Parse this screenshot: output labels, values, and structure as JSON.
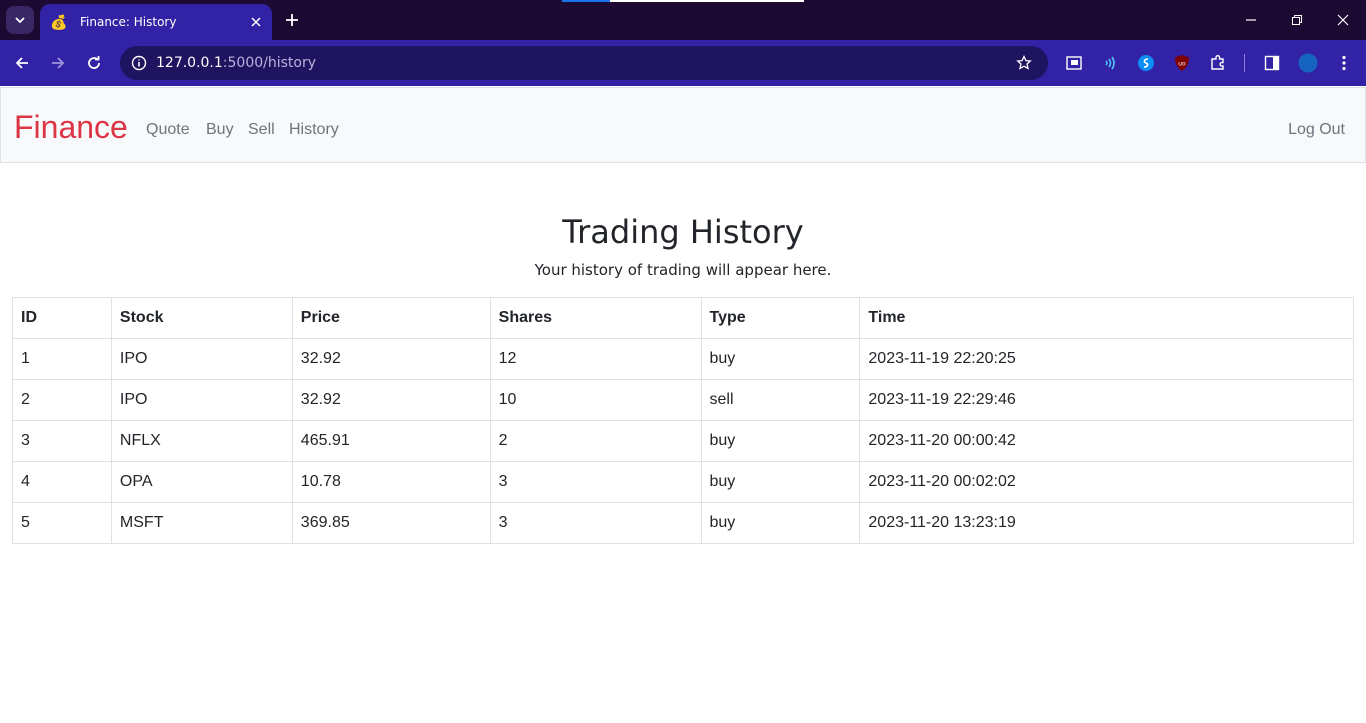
{
  "browser": {
    "tab_title": "Finance: History",
    "url_host": "127.0.0.1",
    "url_path": ":5000/history"
  },
  "navbar": {
    "brand": "Finance",
    "links": [
      "Quote",
      "Buy",
      "Sell",
      "History"
    ],
    "logout": "Log Out"
  },
  "main": {
    "title": "Trading History",
    "subtitle": "Your history of trading will appear here."
  },
  "table": {
    "headers": [
      "ID",
      "Stock",
      "Price",
      "Shares",
      "Type",
      "Time"
    ],
    "rows": [
      [
        "1",
        "IPO",
        "32.92",
        "12",
        "buy",
        "2023-11-19 22:20:25"
      ],
      [
        "2",
        "IPO",
        "32.92",
        "10",
        "sell",
        "2023-11-19 22:29:46"
      ],
      [
        "3",
        "NFLX",
        "465.91",
        "2",
        "buy",
        "2023-11-20 00:00:42"
      ],
      [
        "4",
        "OPA",
        "10.78",
        "3",
        "buy",
        "2023-11-20 00:02:02"
      ],
      [
        "5",
        "MSFT",
        "369.85",
        "3",
        "buy",
        "2023-11-20 13:23:19"
      ]
    ]
  },
  "colors": {
    "brand": "#dc3545",
    "chrome": "#3223a6",
    "tabstrip": "#1d0a33"
  }
}
